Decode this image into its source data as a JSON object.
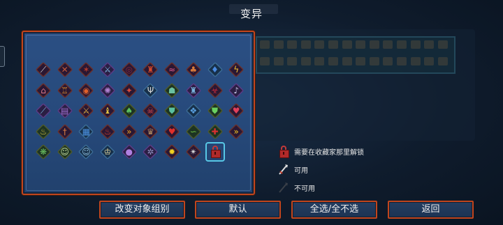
{
  "title": "变异",
  "legend": {
    "locked": "需要在收藏家那里解锁",
    "available": "可用",
    "unavailable": "不可用"
  },
  "buttons": {
    "change_group": "改变对象组别",
    "default": "默认",
    "toggle_all": "全选/全不选",
    "back": "返回"
  },
  "colors": {
    "accent_border": "#c1451d",
    "panel_blue": "#274a7c",
    "selection": "#58c8e6"
  },
  "mutations": [
    {
      "icon": "spear-icon",
      "glyph": "⟋",
      "color": "#d8d8d8",
      "frame": "r"
    },
    {
      "icon": "crossbow-icon",
      "glyph": "✕",
      "color": "#c25a3a",
      "frame": "r"
    },
    {
      "icon": "claw-icon",
      "glyph": "✶",
      "color": "#b23a2a",
      "frame": "r"
    },
    {
      "icon": "blade-icon",
      "glyph": "⚔",
      "color": "#7ab6e0",
      "frame": "p"
    },
    {
      "icon": "blood-rune-icon",
      "glyph": "◎",
      "color": "#8a2a3a",
      "frame": "r"
    },
    {
      "icon": "potion-icon",
      "glyph": "♜",
      "color": "#d84a2a",
      "frame": "r"
    },
    {
      "icon": "worm-icon",
      "glyph": "≈",
      "color": "#e05a8a",
      "frame": "r"
    },
    {
      "icon": "mushroom-icon",
      "glyph": "♣",
      "color": "#d87a3a",
      "frame": "r"
    },
    {
      "icon": "flask-icon",
      "glyph": "♦",
      "color": "#4a8ae0",
      "frame": "b"
    },
    {
      "icon": "lightning-icon",
      "glyph": "ϟ",
      "color": "#f2c230",
      "frame": "r"
    },
    {
      "icon": "bell-icon",
      "glyph": "⌂",
      "color": "#e07a8a",
      "frame": "r"
    },
    {
      "icon": "tower-icon",
      "glyph": "♖",
      "color": "#e0902a",
      "frame": "r"
    },
    {
      "icon": "ring-icon",
      "glyph": "◉",
      "color": "#e0602a",
      "frame": "r"
    },
    {
      "icon": "rune-icon",
      "glyph": "✺",
      "color": "#b080d0",
      "frame": "p"
    },
    {
      "icon": "fire-rune-icon",
      "glyph": "✦",
      "color": "#d84a3a",
      "frame": "r"
    },
    {
      "icon": "trident-icon",
      "glyph": "Ψ",
      "color": "#d8d8d8",
      "frame": "b"
    },
    {
      "icon": "mask-icon",
      "glyph": "☗",
      "color": "#6ac0a0",
      "frame": "g"
    },
    {
      "icon": "castle-icon",
      "glyph": "♜",
      "color": "#7ab6e0",
      "frame": "p"
    },
    {
      "icon": "blood-icon",
      "glyph": "☣",
      "color": "#c02a3a",
      "frame": "r"
    },
    {
      "icon": "horn-icon",
      "glyph": "♪",
      "color": "#c8c8e8",
      "frame": "p"
    },
    {
      "icon": "feather-icon",
      "glyph": "⟋",
      "color": "#7ab6e0",
      "frame": "p"
    },
    {
      "icon": "tome-icon",
      "glyph": "▤",
      "color": "#a070d0",
      "frame": "p"
    },
    {
      "icon": "sword-icon",
      "glyph": "⚔",
      "color": "#e0b040",
      "frame": "r"
    },
    {
      "icon": "statue-icon",
      "glyph": "♝",
      "color": "#e0c040",
      "frame": "r"
    },
    {
      "icon": "green-drop-icon",
      "glyph": "♠",
      "color": "#5ac060",
      "frame": "g"
    },
    {
      "icon": "skull-icon",
      "glyph": "☠",
      "color": "#e04a4a",
      "frame": "r"
    },
    {
      "icon": "shield-icon",
      "glyph": "⛊",
      "color": "#5ac0a0",
      "frame": "g"
    },
    {
      "icon": "emblem-icon",
      "glyph": "❖",
      "color": "#5aa0e0",
      "frame": "b"
    },
    {
      "icon": "green-shield-icon",
      "glyph": "⛊",
      "color": "#6ad060",
      "frame": "g"
    },
    {
      "icon": "crest-icon",
      "glyph": "♥",
      "color": "#e0405a",
      "frame": "r"
    },
    {
      "icon": "goblet-icon",
      "glyph": "♨",
      "color": "#d8c040",
      "frame": "g"
    },
    {
      "icon": "dagger-icon",
      "glyph": "†",
      "color": "#e08040",
      "frame": "r"
    },
    {
      "icon": "blue-crate-icon",
      "glyph": "▦",
      "color": "#4a90e0",
      "frame": "b"
    },
    {
      "icon": "flame-icon",
      "glyph": "♨",
      "color": "#e0402a",
      "frame": "r"
    },
    {
      "icon": "speed-arrows-icon",
      "glyph": "»",
      "color": "#f0a020",
      "frame": "r"
    },
    {
      "icon": "bag-icon",
      "glyph": "♛",
      "color": "#b08a60",
      "frame": "r"
    },
    {
      "icon": "heart-gem-icon",
      "glyph": "♥",
      "color": "#e0302a",
      "frame": "r"
    },
    {
      "icon": "snake-icon",
      "glyph": "∽",
      "color": "#6ac040",
      "frame": "g"
    },
    {
      "icon": "cross-icon",
      "glyph": "✚",
      "color": "#d83030",
      "frame": "g"
    },
    {
      "icon": "double-arrow-icon",
      "glyph": "»",
      "color": "#f0c020",
      "frame": "r"
    },
    {
      "icon": "beetle-icon",
      "glyph": "❋",
      "color": "#6ac060",
      "frame": "g"
    },
    {
      "icon": "skull-mask-icon",
      "glyph": "☺",
      "color": "#c8e0a0",
      "frame": "g"
    },
    {
      "icon": "ghost-icon",
      "glyph": "☺",
      "color": "#90c0e0",
      "frame": "b"
    },
    {
      "icon": "crown-icon",
      "glyph": "♔",
      "color": "#f0e0a0",
      "frame": "b"
    },
    {
      "icon": "orb-icon",
      "glyph": "●",
      "color": "#b080e0",
      "frame": "p"
    },
    {
      "icon": "gear-icon",
      "glyph": "✲",
      "color": "#9090c0",
      "frame": "p"
    },
    {
      "icon": "star-burst-icon",
      "glyph": "✹",
      "color": "#f0d020",
      "frame": "r"
    },
    {
      "icon": "blade-spin-icon",
      "glyph": "✴",
      "color": "#d8d8d8",
      "frame": "r"
    }
  ]
}
